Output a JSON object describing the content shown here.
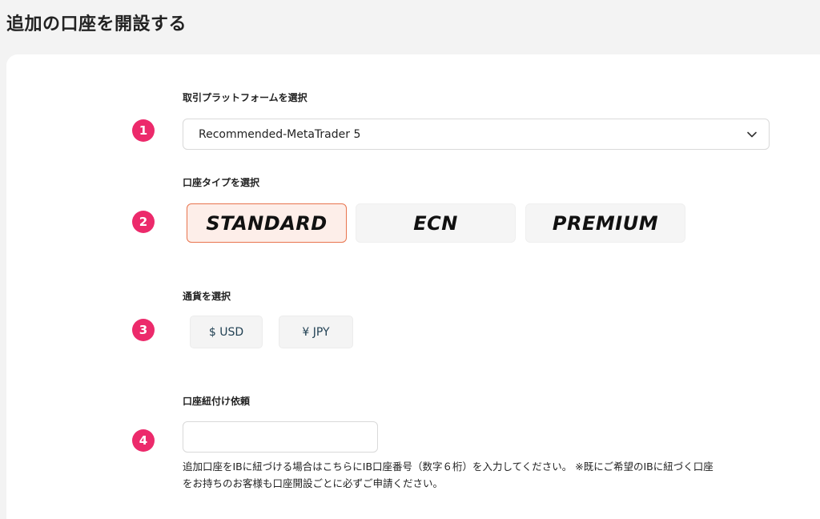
{
  "page": {
    "title": "追加の口座を開設する"
  },
  "sections": {
    "platform": {
      "step": "1",
      "label": "取引プラットフォームを選択",
      "selected_value": "Recommended-MetaTrader 5"
    },
    "account_type": {
      "step": "2",
      "label": "口座タイプを選択",
      "options": [
        "STANDARD",
        "ECN",
        "PREMIUM"
      ],
      "selected": "STANDARD"
    },
    "currency": {
      "step": "3",
      "label": "通貨を選択",
      "options": [
        "$ USD",
        "¥ JPY"
      ]
    },
    "ib_link": {
      "step": "4",
      "label": "口座紐付け依頼",
      "input_value": "",
      "help_line1": "追加口座をIBに紐づける場合はこちらにIB口座番号（数字６桁）を入力してください。 ※既にご希望のIBに紐づく口座",
      "help_line2": "をお持ちのお客様も口座開設ごとに必ずご申請ください。"
    }
  },
  "colors": {
    "step_badge": "#ec2a6b",
    "selected_border": "#e8744e",
    "selected_bg": "#fdeee9",
    "page_bg": "#f3f3f3"
  },
  "icons": {
    "select_arrow": "chevron-down-icon"
  }
}
